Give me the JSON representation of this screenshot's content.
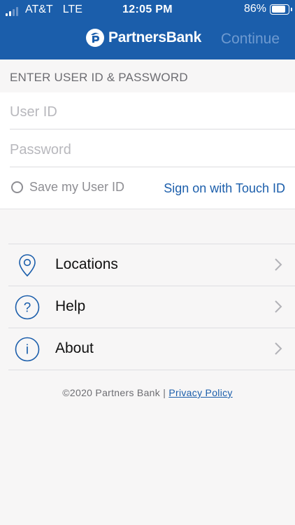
{
  "status_bar": {
    "carrier": "AT&T",
    "network": "LTE",
    "time": "12:05 PM",
    "battery_percent": "86%",
    "battery_level": 0.86
  },
  "header": {
    "brand_name": "PartnersBank",
    "continue_label": "Continue"
  },
  "login": {
    "section_title": "ENTER USER ID & PASSWORD",
    "user_id_placeholder": "User ID",
    "password_placeholder": "Password",
    "save_user_id_label": "Save my User ID",
    "touch_id_label": "Sign on with Touch ID"
  },
  "menu": {
    "items": [
      {
        "label": "Locations",
        "icon": "location-pin-icon"
      },
      {
        "label": "Help",
        "icon": "question-circle-icon"
      },
      {
        "label": "About",
        "icon": "info-circle-icon"
      }
    ]
  },
  "footer": {
    "copyright": "©2020 Partners Bank |",
    "privacy_link": "Privacy Policy"
  },
  "colors": {
    "brand_blue": "#1b5eab",
    "background": "#f7f6f6",
    "continue_disabled": "#6e9ad0"
  }
}
